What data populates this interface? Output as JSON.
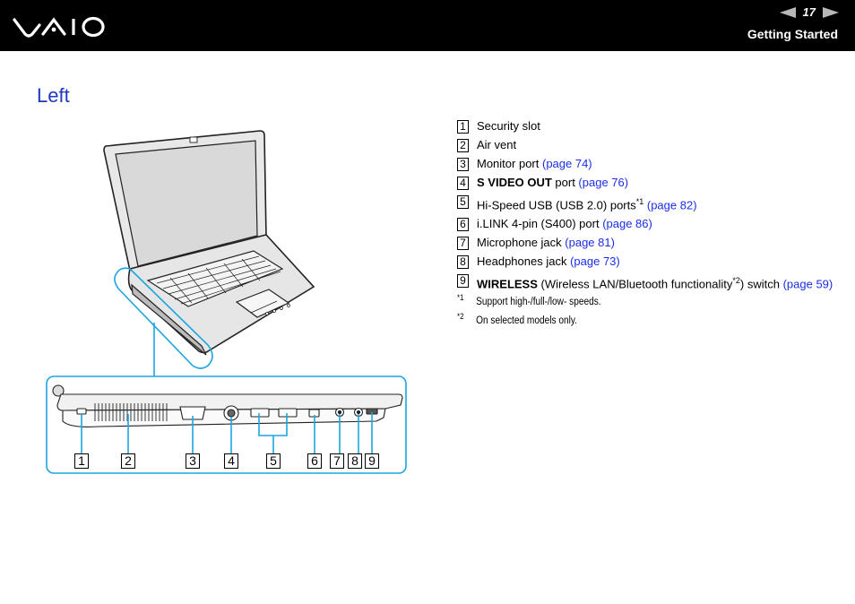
{
  "header": {
    "brand": "VAIO",
    "page_number": "17",
    "section": "Getting Started",
    "prev_icon": "triangle-left-icon",
    "next_icon": "triangle-right-icon"
  },
  "page": {
    "title": "Left"
  },
  "colors": {
    "title": "#2037c0",
    "link": "#1a2ee8",
    "callout": "#1aa6e0"
  },
  "legend": [
    {
      "num": "1",
      "bold": "",
      "text": "Security slot",
      "sup": "",
      "text2": "",
      "link": ""
    },
    {
      "num": "2",
      "bold": "",
      "text": "Air vent",
      "sup": "",
      "text2": "",
      "link": ""
    },
    {
      "num": "3",
      "bold": "",
      "text": "Monitor port ",
      "sup": "",
      "text2": "",
      "link": "(page 74)"
    },
    {
      "num": "4",
      "bold": "S VIDEO OUT",
      "text": " port ",
      "sup": "",
      "text2": "",
      "link": "(page 76)"
    },
    {
      "num": "5",
      "bold": "",
      "text": "Hi-Speed USB (USB 2.0) ports",
      "sup": "*1",
      "text2": " ",
      "link": "(page 82)"
    },
    {
      "num": "6",
      "bold": "",
      "text": "i.LINK 4-pin (S400) port ",
      "sup": "",
      "text2": "",
      "link": "(page 86)"
    },
    {
      "num": "7",
      "bold": "",
      "text": "Microphone jack ",
      "sup": "",
      "text2": "",
      "link": "(page 81)"
    },
    {
      "num": "8",
      "bold": "",
      "text": "Headphones jack ",
      "sup": "",
      "text2": "",
      "link": "(page 73)"
    },
    {
      "num": "9",
      "bold": "WIRELESS",
      "text": " (Wireless LAN/Bluetooth functionality",
      "sup": "*2",
      "text2": ") switch ",
      "link": "(page 59)"
    }
  ],
  "footnotes": [
    {
      "mark": "*1",
      "text": "Support high-/full-/low- speeds."
    },
    {
      "mark": "*2",
      "text": "On selected models only."
    }
  ],
  "illustration": {
    "callout_labels": [
      "1",
      "2",
      "3",
      "4",
      "5",
      "6",
      "7",
      "8",
      "9"
    ]
  }
}
